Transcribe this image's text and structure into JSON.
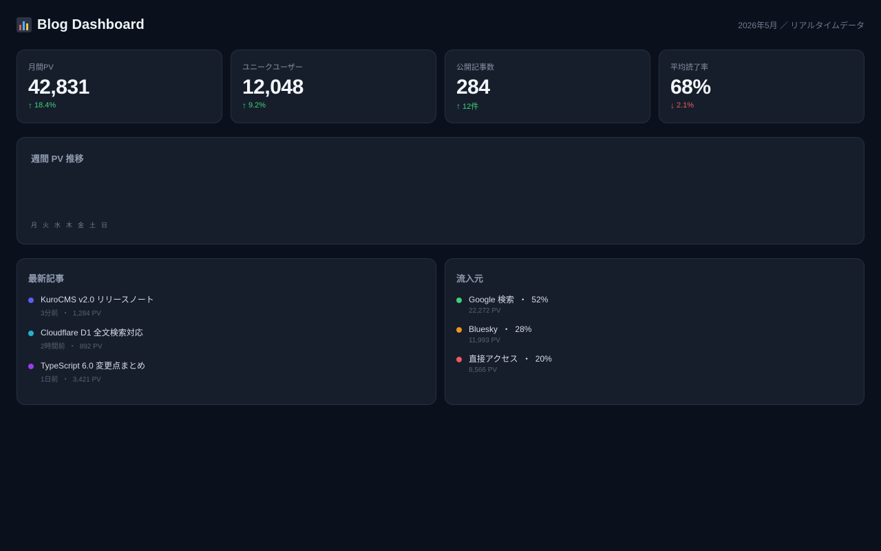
{
  "header": {
    "title": "Blog Dashboard",
    "subtitle": "2026年5月 ／ リアルタイムデータ"
  },
  "stats": [
    {
      "label": "月間PV",
      "value": "42,831",
      "delta": "18.4%",
      "direction": "up"
    },
    {
      "label": "ユニークユーザー",
      "value": "12,048",
      "delta": "9.2%",
      "direction": "up"
    },
    {
      "label": "公開記事数",
      "value": "284",
      "delta": "12件",
      "direction": "up"
    },
    {
      "label": "平均読了率",
      "value": "68%",
      "delta": "2.1%",
      "direction": "down"
    }
  ],
  "weekly_chart": {
    "title": "週間 PV 推移"
  },
  "chart_data": {
    "type": "bar",
    "title": "週間 PV 推移",
    "categories": [
      "月",
      "火",
      "水",
      "木",
      "金",
      "土",
      "日"
    ],
    "values": [],
    "xlabel": "",
    "ylabel": ""
  },
  "recent_posts": {
    "title": "最新記事",
    "items": [
      {
        "title": "KuroCMS v2.0 リリースノート",
        "time": "3分前",
        "pv": "1,284 PV",
        "color": "#5b5ef2"
      },
      {
        "title": "Cloudflare D1 全文検索対応",
        "time": "2時間前",
        "pv": "892 PV",
        "color": "#22b3cf"
      },
      {
        "title": "TypeScript 6.0 変更点まとめ",
        "time": "1日前",
        "pv": "3,421 PV",
        "color": "#9a3df0"
      }
    ]
  },
  "traffic_sources": {
    "title": "流入元",
    "items": [
      {
        "name": "Google 検索",
        "percent": "52%",
        "pv": "22,272 PV",
        "color": "#3fd07a"
      },
      {
        "name": "Bluesky",
        "percent": "28%",
        "pv": "11,993 PV",
        "color": "#f0961e"
      },
      {
        "name": "直接アクセス",
        "percent": "20%",
        "pv": "8,566 PV",
        "color": "#ef5a5a"
      }
    ]
  },
  "separator": "・"
}
